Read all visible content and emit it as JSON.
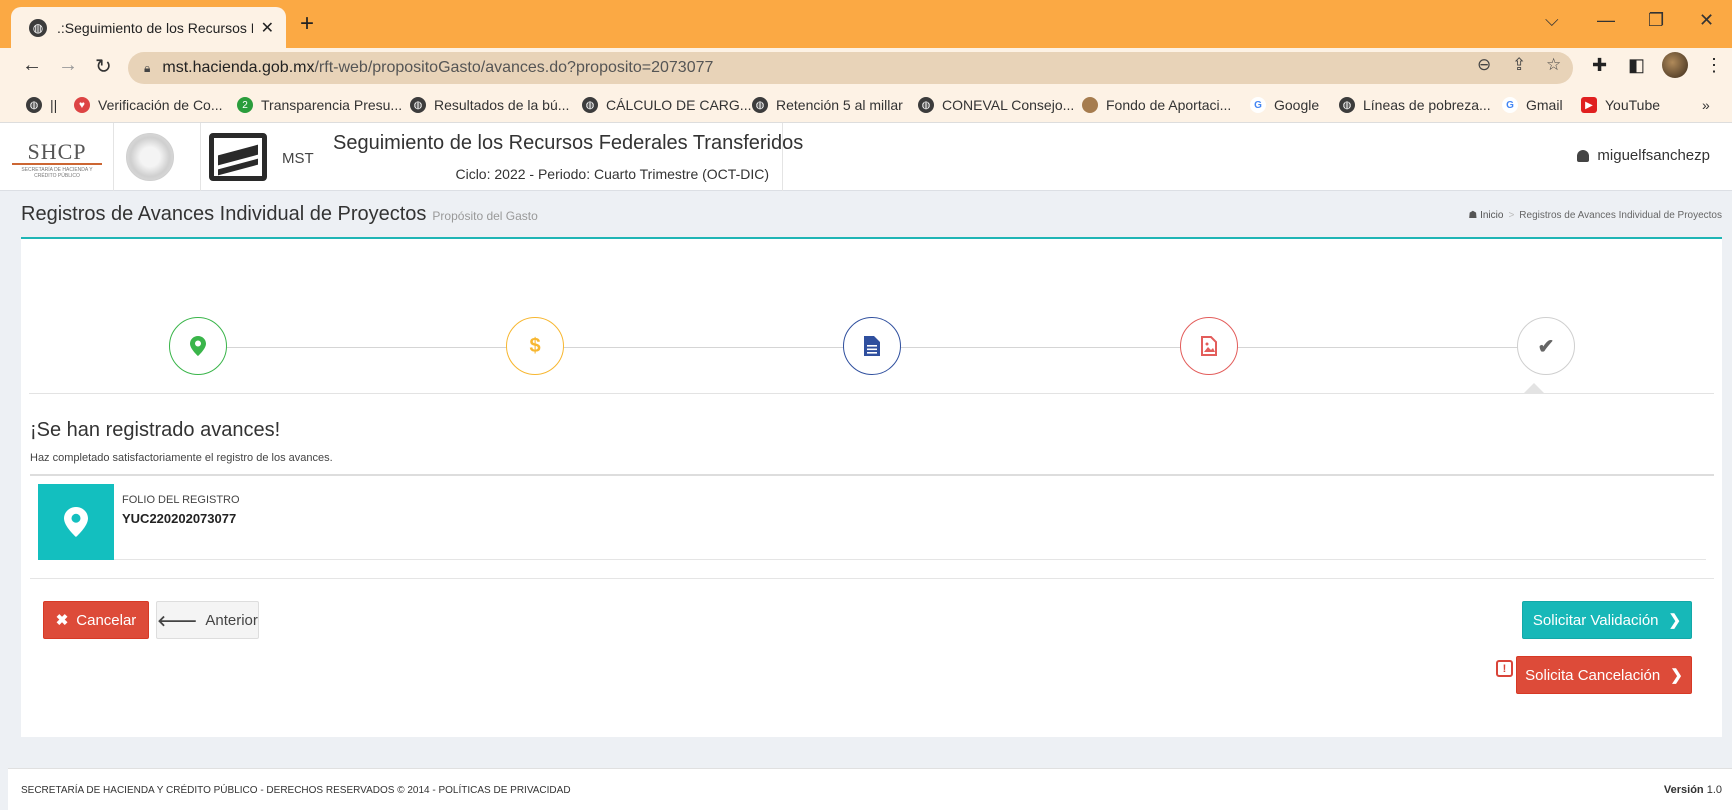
{
  "browser": {
    "tab_title": ".:Seguimiento de los Recursos Fe",
    "url_host": "mst.hacienda.gob.mx",
    "url_path": "/rft-web/propositoGasto/avances.do?proposito=2073077",
    "bookmarks": [
      {
        "label": "||",
        "icon": "globe-icon"
      },
      {
        "label": "Verificación de Co...",
        "icon": "shield-icon"
      },
      {
        "label": "Transparencia Presu...",
        "icon": "green-badge-icon"
      },
      {
        "label": "Resultados de la bú...",
        "icon": "globe-icon"
      },
      {
        "label": "CÁLCULO DE CARG...",
        "icon": "globe-icon"
      },
      {
        "label": "Retención 5 al millar",
        "icon": "globe-icon"
      },
      {
        "label": "CONEVAL Consejo...",
        "icon": "globe-icon"
      },
      {
        "label": "Fondo de Aportaci...",
        "icon": "brown-circle-icon"
      },
      {
        "label": "Google",
        "icon": "google-icon"
      },
      {
        "label": "Líneas de pobreza...",
        "icon": "globe-icon"
      },
      {
        "label": "Gmail",
        "icon": "google-icon"
      },
      {
        "label": "YouTube",
        "icon": "youtube-icon"
      }
    ],
    "more_bookmarks": "»"
  },
  "header": {
    "shcp_logo": "SHCP",
    "shcp_sub": "SECRETARÍA DE HACIENDA Y CRÉDITO PÚBLICO",
    "mst_label": "MST",
    "app_title": "Seguimiento de los Recursos Federales Transferidos",
    "cycle": "Ciclo: 2022 - Periodo: Cuarto Trimestre (OCT-DIC)",
    "username": "miguelfsanchezp"
  },
  "page": {
    "title": "Registros de Avances Individual de Proyectos",
    "subtitle": "Propósito del Gasto",
    "breadcrumb_home": "Inicio",
    "breadcrumb_sep": ">",
    "breadcrumb_current": "Registros de Avances Individual de Proyectos"
  },
  "steps": [
    {
      "name": "location",
      "color": "#3ab54a",
      "glyph": "⚲"
    },
    {
      "name": "money",
      "color": "#f7b731",
      "glyph": "$"
    },
    {
      "name": "document",
      "color": "#2f4f9e",
      "glyph": "▤"
    },
    {
      "name": "image-file",
      "color": "#e35d5b",
      "glyph": "▧"
    },
    {
      "name": "check",
      "color": "#666666",
      "glyph": "✔"
    }
  ],
  "result": {
    "title": "¡Se han registrado avances!",
    "message": "Haz completado satisfactoriamente el registro de los avances.",
    "folio_label": "FOLIO DEL REGISTRO",
    "folio_value": "YUC220202073077"
  },
  "buttons": {
    "cancel": "Cancelar",
    "previous": "Anterior",
    "request_validation": "Solicitar Validación",
    "request_cancellation": "Solicita Cancelación"
  },
  "footer": {
    "text": "SECRETARÍA DE HACIENDA Y CRÉDITO PÚBLICO - DERECHOS RESERVADOS © 2014 - POLÍTICAS DE PRIVACIDAD",
    "version_label": "Versión",
    "version_value": "1.0"
  },
  "colors": {
    "accent_teal": "#1fb5b5",
    "danger": "#dd4b39",
    "chrome_frame": "#fba944"
  }
}
